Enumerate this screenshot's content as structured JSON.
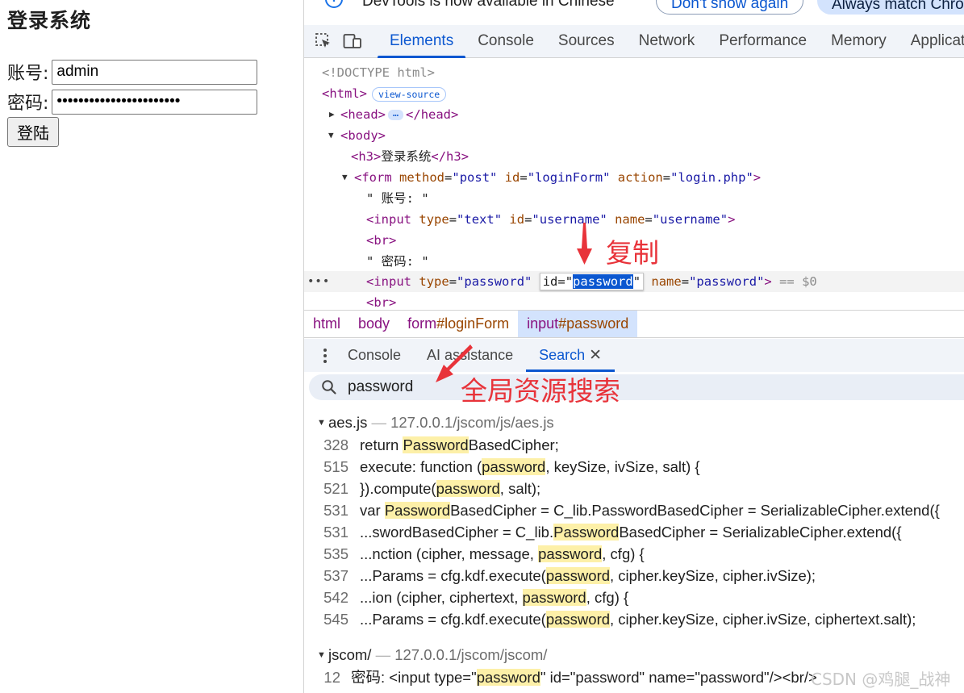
{
  "page": {
    "heading": "登录系统",
    "username_label": "账号:",
    "username_value": "admin",
    "password_label": "密码:",
    "password_value": "abcdefghijklmnopqrstuvw",
    "login_button": "登陆"
  },
  "infobar": {
    "message": "DevTools is now available in Chinese",
    "dont_show_again": "Don't show again",
    "always_match": "Always match Chrome"
  },
  "tabs": [
    "Elements",
    "Console",
    "Sources",
    "Network",
    "Performance",
    "Memory",
    "Application"
  ],
  "dom": {
    "doctype": "<!DOCTYPE html>",
    "html_tag": "html",
    "view_source": "view-source",
    "head_tag": "head",
    "head_ellipsis": "…",
    "body_tag": "body",
    "h3_tag": "h3",
    "h3_text": "登录系统",
    "form": {
      "tag": "form",
      "method": "post",
      "id": "loginForm",
      "action": "login.php"
    },
    "text_account": "\" 账号: \"",
    "input_user": {
      "tag": "input",
      "type": "text",
      "id": "username",
      "name": "username"
    },
    "br": "br",
    "text_password": "\" 密码: \"",
    "input_pass": {
      "tag": "input",
      "type": "password",
      "id": "password",
      "name": "password"
    },
    "selected_marker": "== $0",
    "row_dots": "•••",
    "edit_prefix": "id=\"",
    "edit_suffix": "\""
  },
  "breadcrumbs": [
    {
      "tag": "html",
      "id": ""
    },
    {
      "tag": "body",
      "id": ""
    },
    {
      "tag": "form",
      "id": "#loginForm"
    },
    {
      "tag": "input",
      "id": "#password"
    }
  ],
  "drawer": {
    "tabs": [
      "Console",
      "AI assistance",
      "Search"
    ],
    "close": "✕"
  },
  "search": {
    "query": "password"
  },
  "results": {
    "files": [
      {
        "name": "aes.js",
        "sep": " — ",
        "url": "127.0.0.1/jscom/js/aes.js",
        "lines": [
          {
            "num": "328",
            "segs": [
              [
                "return ",
                false
              ],
              [
                "Password",
                true
              ],
              [
                "BasedCipher;",
                false
              ]
            ]
          },
          {
            "num": "515",
            "segs": [
              [
                "execute: function (",
                false
              ],
              [
                "password",
                true
              ],
              [
                ", keySize, ivSize, salt) {",
                false
              ]
            ]
          },
          {
            "num": "521",
            "segs": [
              [
                "}).compute(",
                false
              ],
              [
                "password",
                true
              ],
              [
                ", salt);",
                false
              ]
            ]
          },
          {
            "num": "531",
            "segs": [
              [
                "var ",
                false
              ],
              [
                "Password",
                true
              ],
              [
                "BasedCipher = C_lib.PasswordBasedCipher = SerializableCipher.extend({",
                false
              ]
            ]
          },
          {
            "num": "531",
            "segs": [
              [
                "...swordBasedCipher = C_lib.",
                false
              ],
              [
                "Password",
                true
              ],
              [
                "BasedCipher = SerializableCipher.extend({",
                false
              ]
            ]
          },
          {
            "num": "535",
            "segs": [
              [
                "...nction (cipher, message, ",
                false
              ],
              [
                "password",
                true
              ],
              [
                ", cfg) {",
                false
              ]
            ]
          },
          {
            "num": "537",
            "segs": [
              [
                "...Params = cfg.kdf.execute(",
                false
              ],
              [
                "password",
                true
              ],
              [
                ", cipher.keySize, cipher.ivSize);",
                false
              ]
            ]
          },
          {
            "num": "542",
            "segs": [
              [
                "...ion (cipher, ciphertext, ",
                false
              ],
              [
                "password",
                true
              ],
              [
                ", cfg) {",
                false
              ]
            ]
          },
          {
            "num": "545",
            "segs": [
              [
                "...Params = cfg.kdf.execute(",
                false
              ],
              [
                "password",
                true
              ],
              [
                ", cipher.keySize, cipher.ivSize, ciphertext.salt);",
                false
              ]
            ]
          }
        ]
      },
      {
        "name": "jscom/",
        "sep": " — ",
        "url": "127.0.0.1/jscom/jscom/",
        "lines": [
          {
            "num": "12",
            "segs": [
              [
                "密码: <input type=\"",
                false
              ],
              [
                "password",
                true
              ],
              [
                "\" id=\"password\" name=\"password\"/><br/>",
                false
              ]
            ]
          }
        ]
      }
    ]
  },
  "annotations": {
    "copy": "复制",
    "global_search": "全局资源搜索",
    "color": "#e8333a"
  },
  "watermark": "CSDN @鸡腿_战神"
}
